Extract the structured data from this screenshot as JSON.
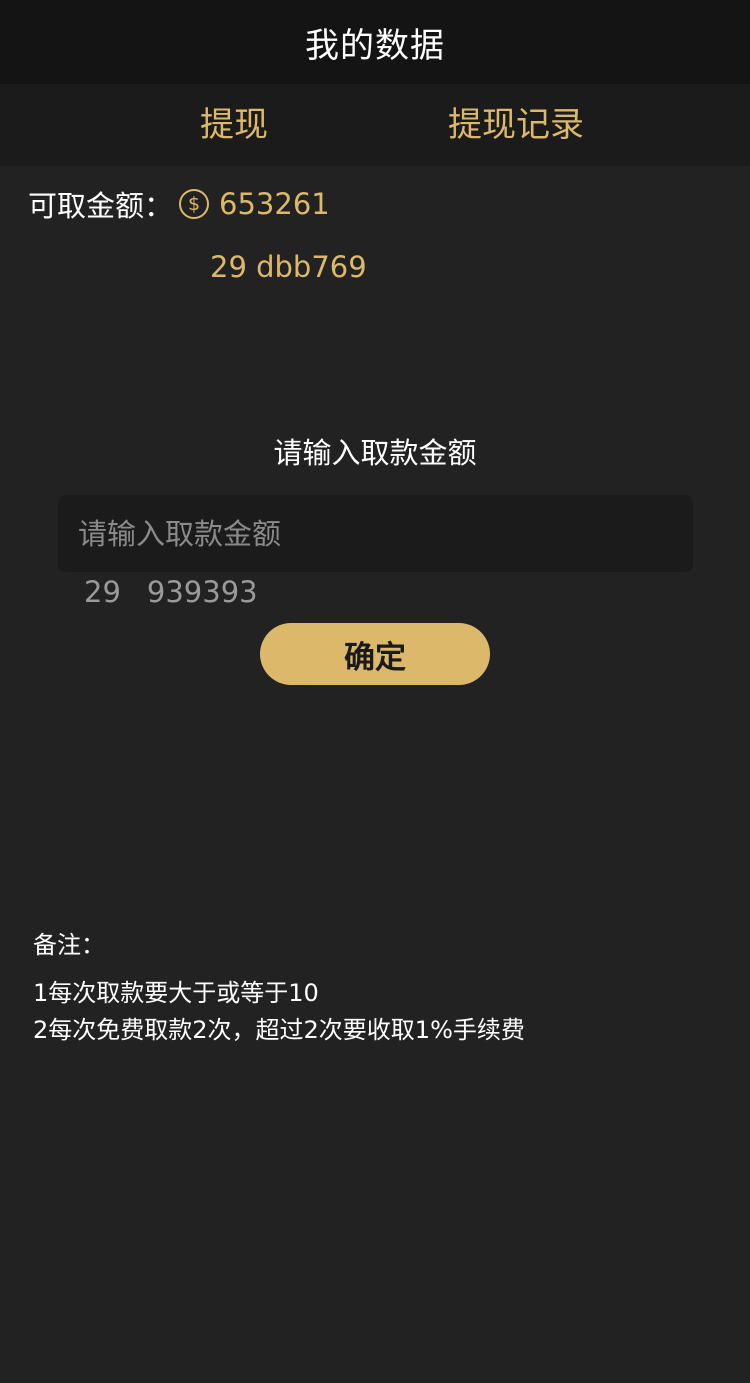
{
  "header": {
    "title": "我的数据"
  },
  "tabs": [
    {
      "label": "提现"
    },
    {
      "label": "提现记录"
    }
  ],
  "balance": {
    "label": "可取金额：",
    "icon": "dollar-coin-icon",
    "value": "653261",
    "extra": "29 dbb769"
  },
  "form": {
    "prompt": "请输入取款金额",
    "input_placeholder": "请输入取款金额",
    "input_value": "",
    "hint_left": "29",
    "hint_right": "939393",
    "confirm_label": "确定"
  },
  "notes": {
    "title": "备注：",
    "lines": [
      "1每次取款要大于或等于10",
      "2每次免费取款2次，超过2次要收取1%手续费"
    ]
  },
  "colors": {
    "background": "#222222",
    "header": "#141414",
    "tabs": "#1b1b1b",
    "accent": "#dcb86b"
  }
}
